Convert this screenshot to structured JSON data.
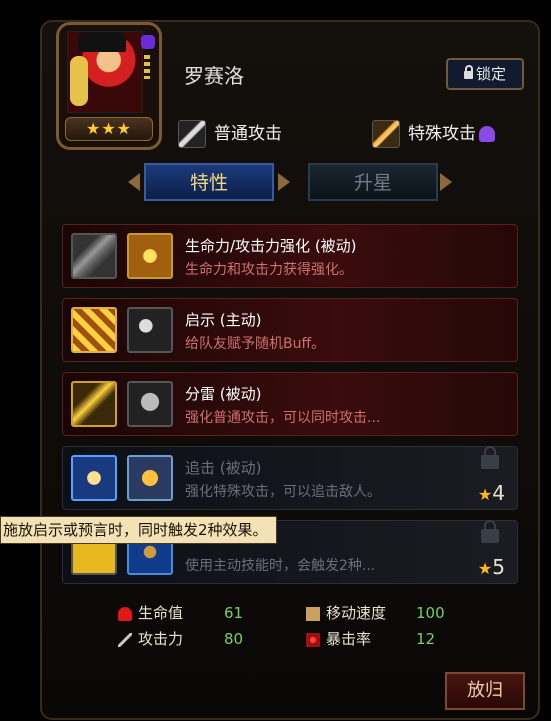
{
  "hero": {
    "name": "罗赛洛",
    "stars": "★★★"
  },
  "lock_button": {
    "label": "锁定"
  },
  "attacks": {
    "normal": "普通攻击",
    "special": "特殊攻击"
  },
  "tabs": [
    "特性",
    "升星"
  ],
  "skills": [
    {
      "title": "生命力/攻击力强化 (被动)",
      "desc": "生命力和攻击力获得强化。",
      "locked": false,
      "icons": [
        "sword-icon",
        "dagger-icon"
      ]
    },
    {
      "title": "启示 (主动)",
      "desc": "给队友赋予随机Buff。",
      "locked": false,
      "icons": [
        "runes-icon",
        "moon-icon"
      ]
    },
    {
      "title": "分雷 (被动)",
      "desc": "强化普通攻击，可以同时攻击...",
      "locked": false,
      "icons": [
        "lightning-icon",
        "storm-icon"
      ]
    },
    {
      "title": "追击 (被动)",
      "desc": "强化特殊攻击，可以追击敌人。",
      "locked": true,
      "req": "4",
      "icons": [
        "burst-icon",
        "star-emblem-icon"
      ]
    },
    {
      "title": "",
      "desc": "使用主动技能时，会触发2种...",
      "locked": true,
      "req": "5",
      "icons": [
        "yellow-icon",
        "blue-icon"
      ]
    }
  ],
  "tooltip": "施放启示或预言时，同时触发2种效果。",
  "stats": {
    "hp": {
      "label": "生命值",
      "value": "61"
    },
    "speed": {
      "label": "移动速度",
      "value": "100"
    },
    "attack": {
      "label": "攻击力",
      "value": "80"
    },
    "crit": {
      "label": "暴击率",
      "value": "12"
    }
  },
  "back_button": {
    "label": "放归"
  },
  "colors": {
    "accent_gold": "#ffcc33",
    "stat_value": "#7ad060",
    "active_row": "#3a0c0c"
  }
}
